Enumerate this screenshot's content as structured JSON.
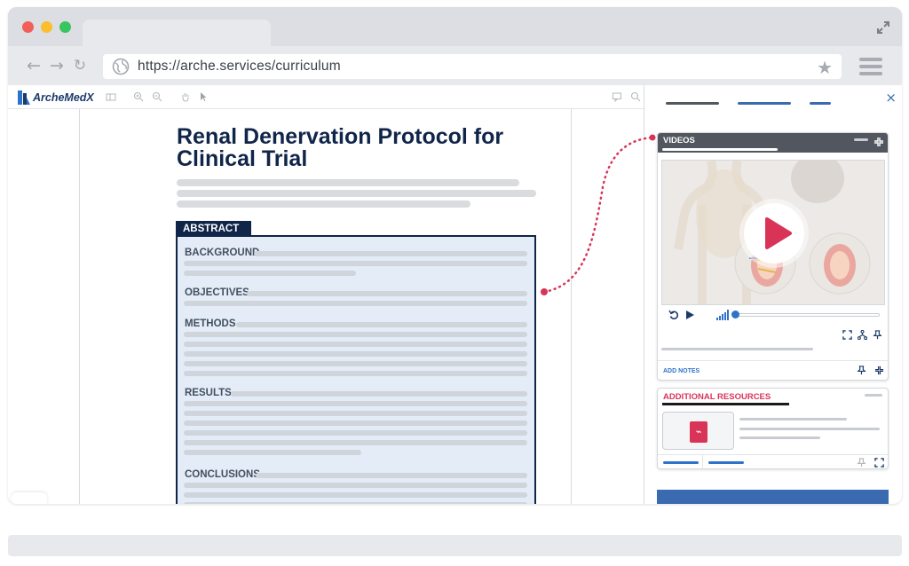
{
  "browser": {
    "url": "https://arche.services/curriculum",
    "traffic_lights": [
      "#f25f58",
      "#fbbe2e",
      "#38c55f"
    ]
  },
  "app": {
    "logo_text": "ArcheMedX"
  },
  "document": {
    "title": "Renal Denervation Protocol for Clinical Trial",
    "abstract_tag": "ABSTRACT",
    "sections": [
      "BACKGROUND",
      "OBJECTIVES",
      "METHODS",
      "RESULTS",
      "CONCLUSIONS"
    ]
  },
  "videos_card": {
    "title": "VIDEOS",
    "add_notes": "ADD NOTES"
  },
  "resources_card": {
    "title": "ADDITIONAL RESOURCES"
  },
  "colors": {
    "navy": "#10254a",
    "accent_red": "#d93458",
    "accent_blue": "#2e73c9"
  }
}
